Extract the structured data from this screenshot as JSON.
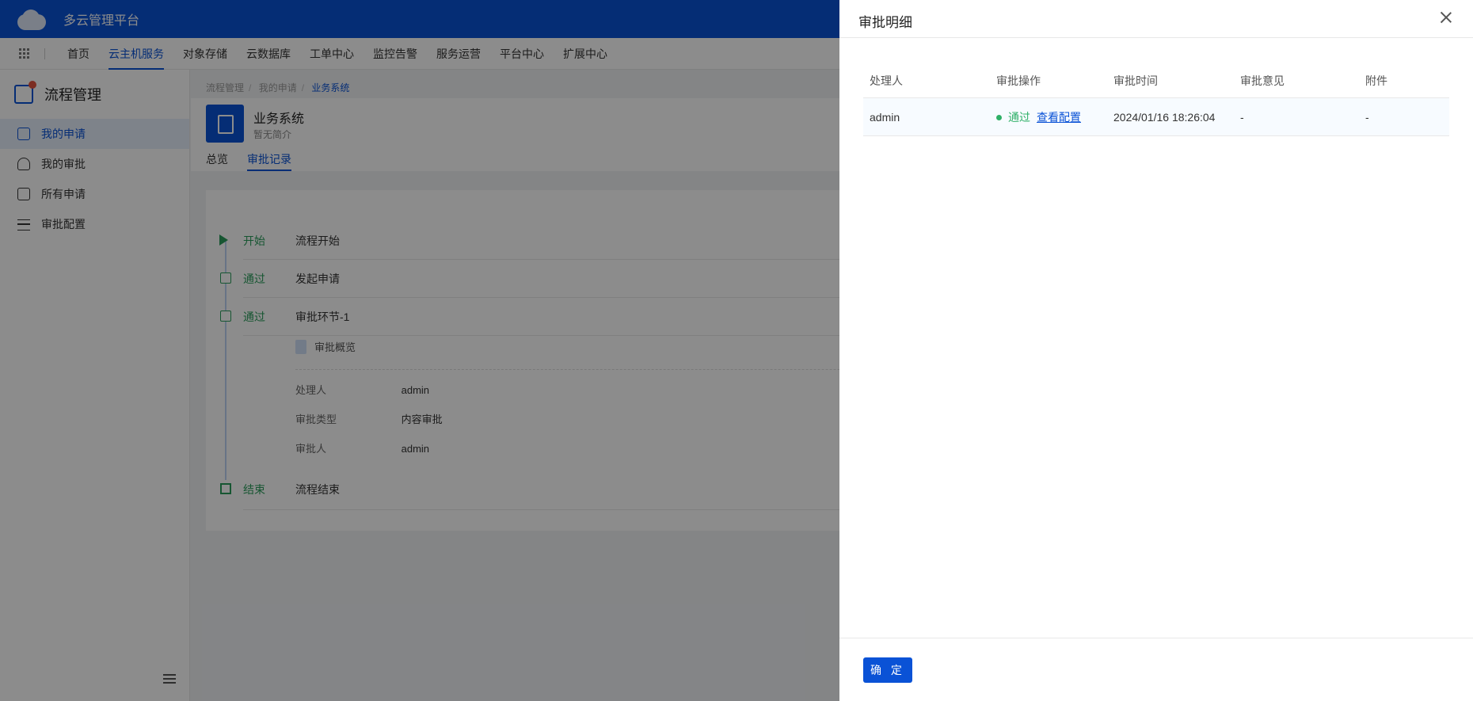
{
  "app": {
    "title": "多云管理平台"
  },
  "nav": {
    "items": [
      {
        "label": "首页"
      },
      {
        "label": "云主机服务"
      },
      {
        "label": "对象存储"
      },
      {
        "label": "云数据库"
      },
      {
        "label": "工单中心"
      },
      {
        "label": "监控告警"
      },
      {
        "label": "服务运营"
      },
      {
        "label": "平台中心"
      },
      {
        "label": "扩展中心"
      }
    ],
    "active": "云主机服务"
  },
  "sidebar": {
    "title": "流程管理",
    "items": [
      {
        "label": "我的申请",
        "icon": "file-upload-icon"
      },
      {
        "label": "我的审批",
        "icon": "stamp-icon"
      },
      {
        "label": "所有申请",
        "icon": "document-icon"
      },
      {
        "label": "审批配置",
        "icon": "list-settings-icon"
      }
    ],
    "active": "我的申请"
  },
  "breadcrumb": [
    "流程管理",
    "我的申请",
    "业务系统"
  ],
  "header": {
    "title": "业务系统",
    "subtitle": "暂无简介"
  },
  "tabs": [
    {
      "label": "总览"
    },
    {
      "label": "审批记录"
    }
  ],
  "timeline": {
    "rows": [
      {
        "status": "开始",
        "name": "流程开始"
      },
      {
        "status": "通过",
        "name": "发起申请"
      },
      {
        "status": "通过",
        "name": "审批环节-1"
      },
      {
        "status": "结束",
        "name": "流程结束"
      }
    ],
    "detail": {
      "title": "审批概览",
      "fields": [
        {
          "key": "处理人",
          "value": "admin"
        },
        {
          "key": "审批类型",
          "value": "内容审批"
        },
        {
          "key": "审批人",
          "value": "admin"
        }
      ]
    }
  },
  "drawer": {
    "title": "审批明细",
    "columns": [
      "处理人",
      "审批操作",
      "审批时间",
      "审批意见",
      "附件"
    ],
    "rows": [
      {
        "handler": "admin",
        "action": "通过",
        "action_link": "查看配置",
        "time": "2024/01/16 18:26:04",
        "opinion": "-",
        "attachment": "-"
      }
    ],
    "confirm_label": "确 定"
  },
  "colors": {
    "primary": "#0a52d6",
    "success": "#2fb067",
    "timeline_green": "#2a9d5b"
  }
}
